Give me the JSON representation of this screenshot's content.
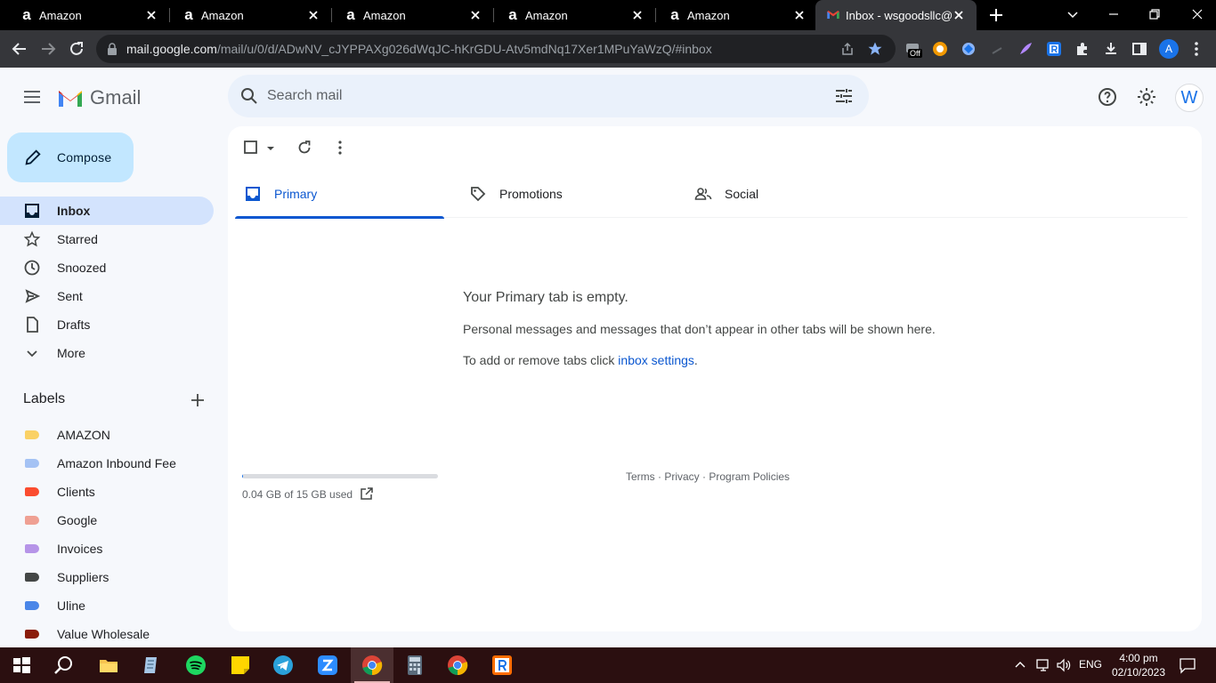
{
  "browser": {
    "tabs": [
      {
        "label": "Amazon",
        "favicon": "amazon-a"
      },
      {
        "label": "Amazon",
        "favicon": "amazon-a"
      },
      {
        "label": "Amazon",
        "favicon": "amazon-a"
      },
      {
        "label": "Amazon",
        "favicon": "amazon-a"
      },
      {
        "label": "Amazon",
        "favicon": "amazon-a"
      },
      {
        "label": "Inbox - wsgoodsllc@",
        "favicon": "gmail-icon",
        "active": true
      }
    ],
    "favicon_glyph": "a",
    "url_host": "mail.google.com",
    "url_path": "/mail/u/0/d/ADwNV_cJYPPAXg026dWqJC-hKrGDU-Atv5mdNq17Xer1MPuYaWzQ/#inbox",
    "extension_badge": "Off",
    "profile_initial": "A"
  },
  "gmail": {
    "wordmark": "Gmail",
    "search_placeholder": "Search mail",
    "account_initial": "W",
    "compose_label": "Compose",
    "nav": [
      {
        "label": "Inbox",
        "icon": "inbox-icon",
        "active": true
      },
      {
        "label": "Starred",
        "icon": "star-icon"
      },
      {
        "label": "Snoozed",
        "icon": "clock-icon"
      },
      {
        "label": "Sent",
        "icon": "send-icon"
      },
      {
        "label": "Drafts",
        "icon": "draft-icon"
      },
      {
        "label": "More",
        "icon": "chevron-down-icon"
      }
    ],
    "labels_heading": "Labels",
    "labels": [
      {
        "name": "AMAZON",
        "color": "#fad165"
      },
      {
        "name": "Amazon Inbound Fee",
        "color": "#a4c2f4"
      },
      {
        "name": "Clients",
        "color": "#fb4c2f"
      },
      {
        "name": "Google",
        "color": "#efa093"
      },
      {
        "name": "Invoices",
        "color": "#b694e8"
      },
      {
        "name": "Suppliers",
        "color": "#444746"
      },
      {
        "name": "Uline",
        "color": "#4a86e8"
      },
      {
        "name": "Value Wholesale",
        "color": "#8a1c0a"
      }
    ],
    "tabs": [
      {
        "label": "Primary",
        "icon": "inbox-tab-icon",
        "active": true
      },
      {
        "label": "Promotions",
        "icon": "tag-icon"
      },
      {
        "label": "Social",
        "icon": "people-icon"
      }
    ],
    "empty": {
      "title": "Your Primary tab is empty.",
      "subtitle": "Personal messages and messages that don’t appear in other tabs will be shown here.",
      "hint_prefix": "To add or remove tabs click ",
      "hint_link": "inbox settings",
      "hint_suffix": "."
    },
    "storage": {
      "text": "0.04 GB of 15 GB used",
      "used_fraction": 0.003
    },
    "footer": {
      "terms": "Terms",
      "privacy": "Privacy",
      "policies": "Program Policies",
      "sep": " · "
    }
  },
  "taskbar": {
    "language": "ENG",
    "time": "4:00 pm",
    "date": "02/10/2023"
  },
  "colors": {
    "accent": "#0b57d0",
    "compose_bg": "#c2e7ff",
    "active_nav_bg": "#d3e3fd",
    "search_bg": "#eaf1fb",
    "taskbar_bg": "#2b0f10"
  }
}
